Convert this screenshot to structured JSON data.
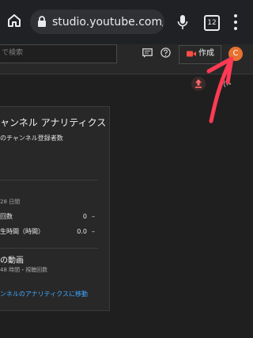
{
  "browser": {
    "url": "studio.youtube.com/cha",
    "tab_count": "12",
    "icons": [
      "home-icon",
      "lock-icon",
      "mic-icon",
      "tabs-icon",
      "more-vert-icon"
    ]
  },
  "header": {
    "search_placeholder": "で検索",
    "create_label": "作成",
    "avatar_letter": "C",
    "avatar_color": "#e7712f",
    "icons": [
      "feedback-icon",
      "help-icon",
      "camera-icon",
      "upload-icon",
      "status-icon"
    ]
  },
  "card": {
    "title": "ャンネル アナリティクス",
    "subscribers_label": "のチャンネル登録者数",
    "period": "28 日間",
    "metrics": [
      {
        "label": "回数",
        "value": "0",
        "delta": "–"
      },
      {
        "label": "生時間（時間）",
        "value": "0.0",
        "delta": "–"
      }
    ],
    "videos_title": "の動画",
    "videos_sub": "48 時間・視聴回数",
    "link_text": "ンネルのアナリティクスに移動",
    "link_color": "#3ea6ff"
  },
  "annotation": {
    "arrow_color": "#ff3a54"
  }
}
